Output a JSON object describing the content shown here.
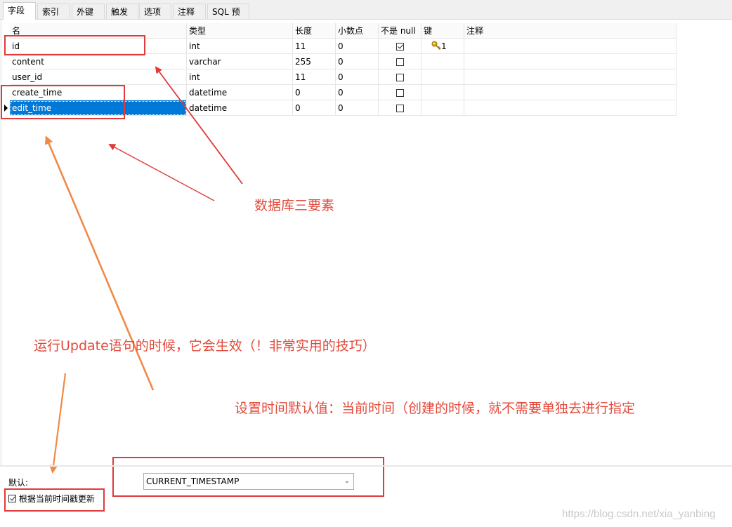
{
  "tabs": [
    {
      "label": "字段",
      "active": true
    },
    {
      "label": "索引",
      "active": false
    },
    {
      "label": "外键",
      "active": false
    },
    {
      "label": "触发器",
      "active": false
    },
    {
      "label": "选项",
      "active": false
    },
    {
      "label": "注释",
      "active": false
    },
    {
      "label": "SQL 预览",
      "active": false
    }
  ],
  "table": {
    "columns": [
      "名",
      "类型",
      "长度",
      "小数点",
      "不是 null",
      "键",
      "注释"
    ],
    "rows": [
      {
        "name": "id",
        "type": "int",
        "length": "11",
        "decimals": "0",
        "not_null": true,
        "key": "1",
        "comment": "",
        "selected": false
      },
      {
        "name": "content",
        "type": "varchar",
        "length": "255",
        "decimals": "0",
        "not_null": false,
        "key": "",
        "comment": "",
        "selected": false
      },
      {
        "name": "user_id",
        "type": "int",
        "length": "11",
        "decimals": "0",
        "not_null": false,
        "key": "",
        "comment": "",
        "selected": false
      },
      {
        "name": "create_time",
        "type": "datetime",
        "length": "0",
        "decimals": "0",
        "not_null": false,
        "key": "",
        "comment": "",
        "selected": false
      },
      {
        "name": "edit_time",
        "type": "datetime",
        "length": "0",
        "decimals": "0",
        "not_null": false,
        "key": "",
        "comment": "",
        "selected": true
      }
    ]
  },
  "annotations": {
    "three_elements": "数据库三要素",
    "update_tip": "运行Update语句的时候，它会生效（！非常实用的技巧）",
    "default_tip": "设置时间默认值：当前时间（创建的时候，就不需要单独去进行指定"
  },
  "bottom": {
    "default_label": "默认:",
    "default_value": "CURRENT_TIMESTAMP",
    "update_checkbox_label": "根据当前时间戳更新",
    "update_checkbox_checked": true
  },
  "watermark": "https://blog.csdn.net/xia_yanbing",
  "colors": {
    "annotation_red": "#e24a3b",
    "arrow_orange": "#f08a45",
    "selection_blue": "#0078d7",
    "key_gold": "#d4a017"
  }
}
